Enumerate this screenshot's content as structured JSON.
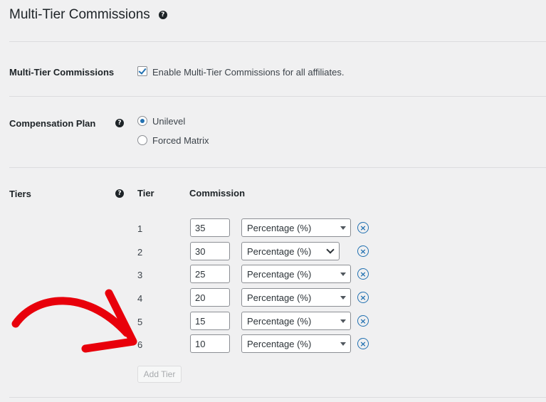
{
  "page": {
    "title": "Multi-Tier Commissions"
  },
  "enable_section": {
    "label": "Multi-Tier Commissions",
    "checkbox_label": "Enable Multi-Tier Commissions for all affiliates.",
    "checked": true
  },
  "plan_section": {
    "label": "Compensation Plan",
    "options": [
      {
        "label": "Unilevel",
        "selected": true
      },
      {
        "label": "Forced Matrix",
        "selected": false
      }
    ]
  },
  "tiers_section": {
    "label": "Tiers",
    "col_tier": "Tier",
    "col_commission": "Commission",
    "rows": [
      {
        "tier": "1",
        "commission": "35",
        "type": "Percentage (%)"
      },
      {
        "tier": "2",
        "commission": "30",
        "type": "Percentage (%)"
      },
      {
        "tier": "3",
        "commission": "25",
        "type": "Percentage (%)"
      },
      {
        "tier": "4",
        "commission": "20",
        "type": "Percentage (%)"
      },
      {
        "tier": "5",
        "commission": "15",
        "type": "Percentage (%)"
      },
      {
        "tier": "6",
        "commission": "10",
        "type": "Percentage (%)"
      }
    ],
    "add_button": "Add Tier"
  },
  "colors": {
    "accent": "#2271b1",
    "annotation_arrow": "#e8000b",
    "background": "#f0f0f1"
  }
}
